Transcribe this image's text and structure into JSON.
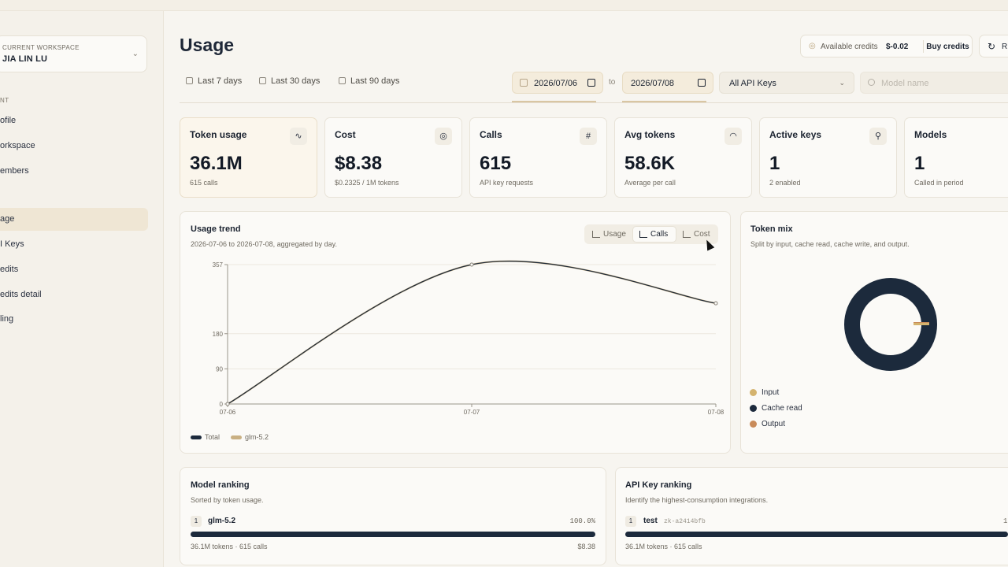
{
  "sidebar": {
    "workspace_label": "CURRENT WORKSPACE",
    "workspace_name": "JIA LIN LU",
    "section_label": "NT",
    "items": [
      {
        "label": "ofile"
      },
      {
        "label": "orkspace"
      },
      {
        "label": "embers"
      },
      {
        "label": "age"
      },
      {
        "label": "I Keys"
      },
      {
        "label": "edits"
      },
      {
        "label": "edits detail"
      },
      {
        "label": "ling"
      }
    ]
  },
  "header": {
    "title": "Usage",
    "available_credits_label": "Available credits",
    "available_credits_value": "$-0.02",
    "buy_credits_label": "Buy credits",
    "refresh_label": "R"
  },
  "filters": {
    "ranges": [
      "Last 7 days",
      "Last 30 days",
      "Last 90 days"
    ],
    "date_from": "2026/07/06",
    "to_label": "to",
    "date_to": "2026/07/08",
    "api_key_select": "All API Keys",
    "model_placeholder": "Model name"
  },
  "stats": [
    {
      "label": "Token usage",
      "value": "36.1M",
      "sub": "615 calls",
      "icon": "activity-icon",
      "glyph": "∿"
    },
    {
      "label": "Cost",
      "value": "$8.38",
      "sub": "$0.2325 / 1M tokens",
      "icon": "coins-icon",
      "glyph": "◎"
    },
    {
      "label": "Calls",
      "value": "615",
      "sub": "API key requests",
      "icon": "hash-icon",
      "glyph": "#"
    },
    {
      "label": "Avg tokens",
      "value": "58.6K",
      "sub": "Average per call",
      "icon": "gauge-icon",
      "glyph": "◠"
    },
    {
      "label": "Active keys",
      "value": "1",
      "sub": "2 enabled",
      "icon": "key-icon",
      "glyph": "⚲"
    },
    {
      "label": "Models",
      "value": "1",
      "sub": "Called in period",
      "icon": "cube-icon",
      "glyph": "▢"
    }
  ],
  "trend": {
    "title": "Usage trend",
    "subtitle": "2026-07-06 to 2026-07-08, aggregated by day.",
    "tabs": [
      "Usage",
      "Calls",
      "Cost"
    ],
    "active_tab": "Calls",
    "legend": [
      "Total",
      "glm-5.2"
    ]
  },
  "chart_data": {
    "type": "line",
    "x": [
      "07-06",
      "07-07",
      "07-08"
    ],
    "series": [
      {
        "name": "Total",
        "values": [
          0,
          357,
          258
        ],
        "color": "#1c2a3c"
      },
      {
        "name": "glm-5.2",
        "values": [
          0,
          357,
          258
        ],
        "color": "#c9b083"
      }
    ],
    "yticks": [
      0,
      90,
      180,
      357
    ],
    "ylim": [
      0,
      357
    ]
  },
  "token_mix": {
    "title": "Token mix",
    "subtitle": "Split by input, cache read, cache write, and output.",
    "legend": [
      {
        "label": "Input",
        "color": "#d4b36e"
      },
      {
        "label": "Cache read",
        "color": "#1c2a3c"
      },
      {
        "label": "Output",
        "color": "#c98b5a"
      }
    ]
  },
  "model_ranking": {
    "title": "Model ranking",
    "subtitle": "Sorted by token usage.",
    "rows": [
      {
        "rank": "1",
        "name": "glm-5.2",
        "pct": "100.0%",
        "meta": "36.1M tokens · 615 calls",
        "cost": "$8.38",
        "share": 1.0
      }
    ]
  },
  "key_ranking": {
    "title": "API Key ranking",
    "subtitle": "Identify the highest-consumption integrations.",
    "rows": [
      {
        "rank": "1",
        "name": "test",
        "key": "zk-a2414bfb",
        "pct": "1",
        "meta": "36.1M tokens · 615 calls",
        "share": 1.0
      }
    ]
  }
}
